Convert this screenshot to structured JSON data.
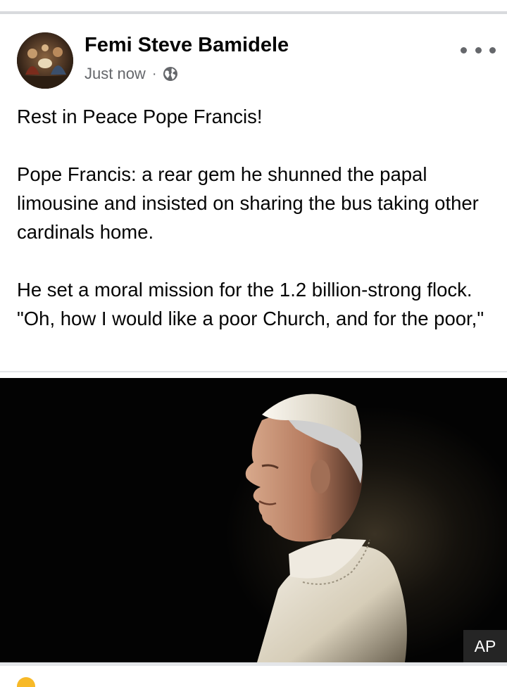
{
  "post": {
    "author": "Femi Steve Bamidele",
    "timestamp": "Just now",
    "separator": "·",
    "privacy_icon": "globe-icon",
    "more_icon": "more-options-icon",
    "paragraphs": [
      "Rest in Peace Pope Francis!",
      "Pope Francis: a rear gem he shunned the papal limousine and insisted on sharing the bus taking other cardinals home.",
      "He set a moral mission for the 1.2 billion-strong flock. \"Oh, how I would like a poor Church, and for the poor,\""
    ],
    "photo": {
      "credit": "AP"
    }
  },
  "colors": {
    "text_primary": "#050505",
    "text_secondary": "#65676b",
    "divider": "#e4e6e9",
    "photo_background": "#030303",
    "reaction_like": "#f7b928"
  }
}
